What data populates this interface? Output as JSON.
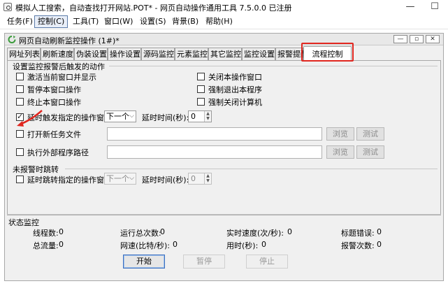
{
  "window": {
    "title": "模拟人工搜索，自动查找打开网站.POT* - 网页自动操作通用工具 7.5.0.0 已注册",
    "minimize": "—",
    "maximize": "☐"
  },
  "menu": [
    {
      "label": "任务(F)"
    },
    {
      "label": "控制(C)"
    },
    {
      "label": "工具(T)"
    },
    {
      "label": "窗口(W)"
    },
    {
      "label": "设置(S)"
    },
    {
      "label": "背景(B)"
    },
    {
      "label": "帮助(H)"
    }
  ],
  "child_window": {
    "title": "网页自动刷新监控操作 (1#)*",
    "controls": [
      "—",
      "▫",
      "✕"
    ]
  },
  "tabs": [
    {
      "label": "网址列表"
    },
    {
      "label": "刷新速度"
    },
    {
      "label": "伪装设置"
    },
    {
      "label": "操作设置"
    },
    {
      "label": "源码监控"
    },
    {
      "label": "元素监控"
    },
    {
      "label": "其它监控"
    },
    {
      "label": "监控设置"
    },
    {
      "label": "报警提醒"
    },
    {
      "label": "流程控制"
    }
  ],
  "alarm_group": {
    "title": "设置监控报警后触发的动作",
    "activate_window": "激活当前窗口并显示",
    "pause_window": "暂停本窗口操作",
    "stop_window": "终止本窗口操作",
    "close_window": "关闭本操作窗口",
    "force_exit": "强制退出本程序",
    "force_shutdown": "强制关闭计算机",
    "delay_trigger": {
      "label": "延时触发指定的操作窗口:",
      "checked": true,
      "combo_value": "下一个",
      "delay_label": "延时时间(秒):",
      "delay_value": "0"
    },
    "open_task": {
      "label": "打开新任务文件",
      "browse": "浏览",
      "test": "测试"
    },
    "run_external": {
      "label": "执行外部程序路径",
      "browse": "浏览",
      "test": "测试"
    }
  },
  "no_alarm_group": {
    "title": "未报警时跳转",
    "delay_jump": {
      "label": "延时跳转指定的操作窗口:",
      "combo_value": "下一个",
      "delay_label": "延时时间(秒):",
      "delay_value": "0"
    }
  },
  "status": {
    "title": "状态监控",
    "threads": {
      "label": "线程数:",
      "value": "0"
    },
    "total_runs": {
      "label": "运行总次数:",
      "value": "0"
    },
    "realtime_speed": {
      "label": "实时速度(次/秒):",
      "value": "0"
    },
    "title_errors": {
      "label": "标题错误:",
      "value": "0"
    },
    "total_traffic": {
      "label": "总流量:",
      "value": "0"
    },
    "net_speed": {
      "label": "网速(比特/秒):",
      "value": "0"
    },
    "time_used": {
      "label": "用时(秒):",
      "value": "0"
    },
    "alarm_count": {
      "label": "报警次数:",
      "value": "0"
    }
  },
  "buttons": {
    "start": "开始",
    "pause": "暂停",
    "stop": "停止"
  },
  "colors": {
    "highlight": "#e0261f",
    "accent": "#3b6fbf"
  }
}
